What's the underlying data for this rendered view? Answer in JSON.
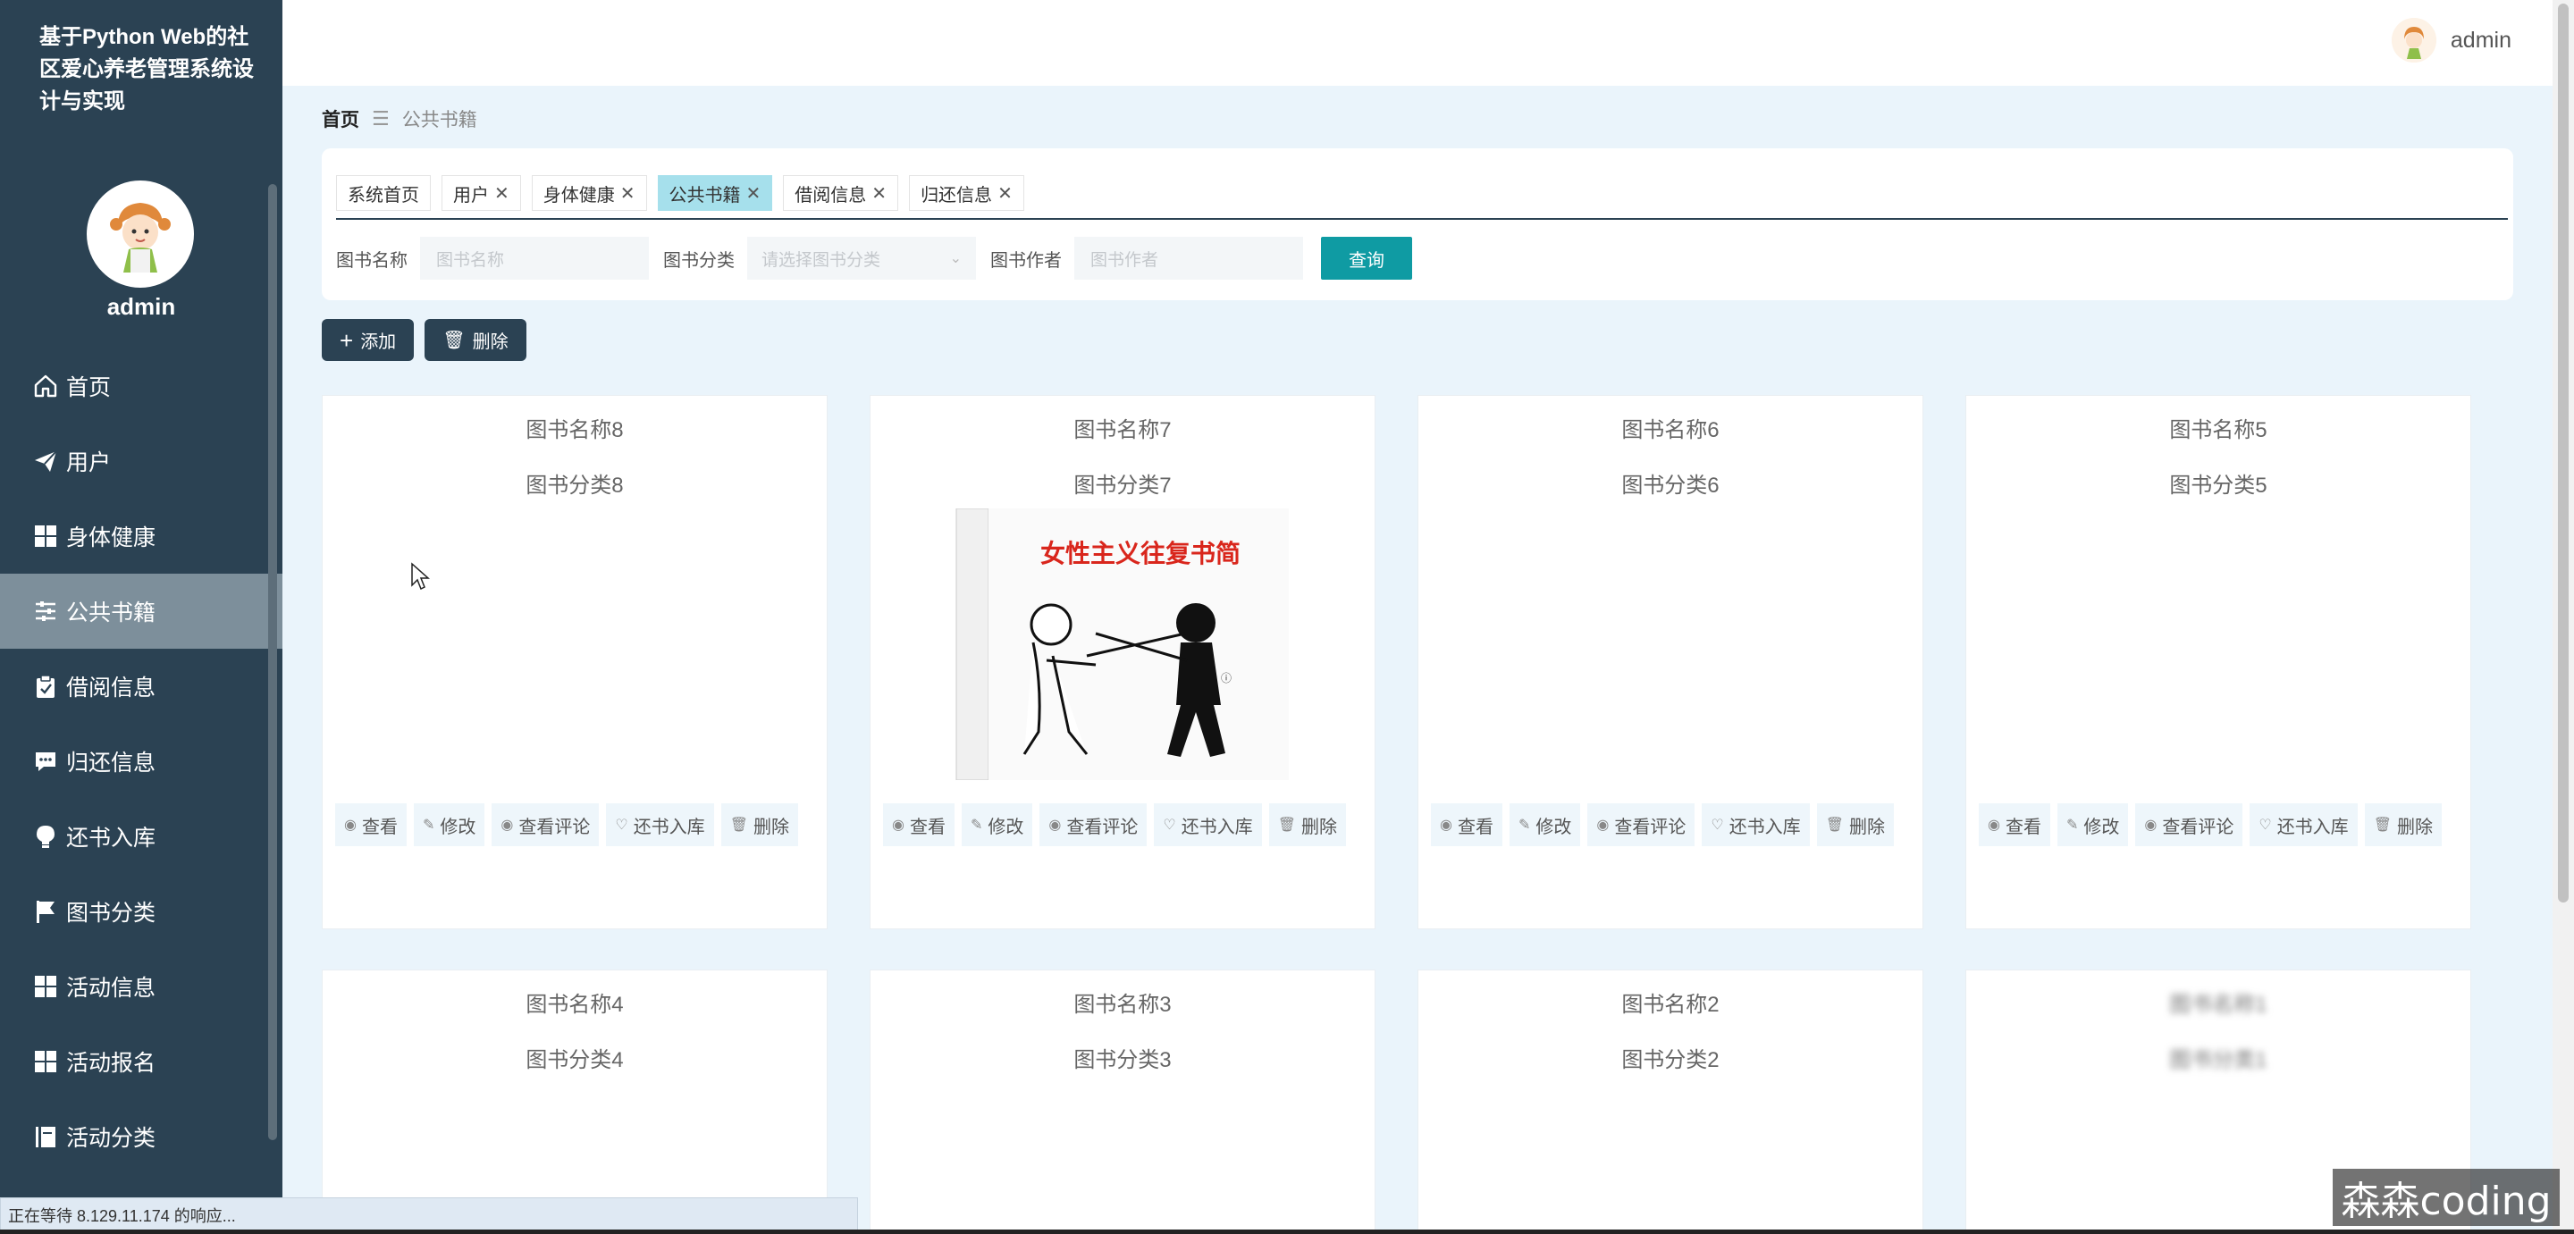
{
  "sidebar": {
    "title": "基于Python Web的社区爱心养老管理系统设计与实现",
    "username": "admin",
    "items": [
      {
        "label": "首页",
        "icon": "home-icon"
      },
      {
        "label": "用户",
        "icon": "paper-plane-icon"
      },
      {
        "label": "身体健康",
        "icon": "grid-icon"
      },
      {
        "label": "公共书籍",
        "icon": "sliders-icon",
        "active": true
      },
      {
        "label": "借阅信息",
        "icon": "clipboard-icon"
      },
      {
        "label": "归还信息",
        "icon": "chat-icon"
      },
      {
        "label": "还书入库",
        "icon": "bulb-icon"
      },
      {
        "label": "图书分类",
        "icon": "flag-icon"
      },
      {
        "label": "活动信息",
        "icon": "grid-icon"
      },
      {
        "label": "活动报名",
        "icon": "grid-icon"
      },
      {
        "label": "活动分类",
        "icon": "book-icon"
      }
    ]
  },
  "header": {
    "username": "admin"
  },
  "breadcrumb": {
    "home": "首页",
    "current": "公共书籍"
  },
  "tabs": [
    {
      "label": "系统首页",
      "closable": false
    },
    {
      "label": "用户",
      "closable": true
    },
    {
      "label": "身体健康",
      "closable": true
    },
    {
      "label": "公共书籍",
      "closable": true,
      "active": true
    },
    {
      "label": "借阅信息",
      "closable": true
    },
    {
      "label": "归还信息",
      "closable": true
    }
  ],
  "search": {
    "name_label": "图书名称",
    "name_placeholder": "图书名称",
    "category_label": "图书分类",
    "category_placeholder": "请选择图书分类",
    "author_label": "图书作者",
    "author_placeholder": "图书作者",
    "query_button": "查询"
  },
  "toolbar": {
    "add_label": "添加",
    "delete_label": "删除"
  },
  "card_buttons": {
    "view": "查看",
    "edit": "修改",
    "comments": "查看评论",
    "return": "还书入库",
    "delete": "删除"
  },
  "books": [
    {
      "name": "图书名称8",
      "category": "图书分类8"
    },
    {
      "name": "图书名称7",
      "category": "图书分类7",
      "cover_title": "女性主义往复书简"
    },
    {
      "name": "图书名称6",
      "category": "图书分类6"
    },
    {
      "name": "图书名称5",
      "category": "图书分类5"
    },
    {
      "name": "图书名称4",
      "category": "图书分类4"
    },
    {
      "name": "图书名称3",
      "category": "图书分类3"
    },
    {
      "name": "图书名称2",
      "category": "图书分类2"
    },
    {
      "name": "图书名称1",
      "category": "图书分类1"
    }
  ],
  "statusbar": "正在等待 8.129.11.174 的响应...",
  "watermark": "森森coding",
  "colors": {
    "sidebar": "#2b4253",
    "accent": "#0f9ba3",
    "active_tab": "#a6e0ec",
    "background": "#eaf4fb"
  }
}
